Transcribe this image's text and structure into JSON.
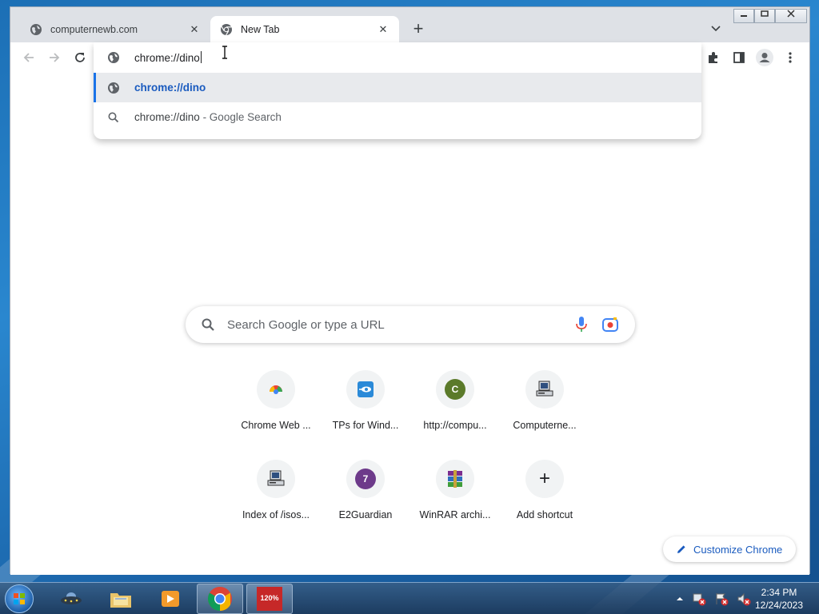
{
  "window": {
    "tabs": [
      {
        "title": "computernewb.com",
        "active": false,
        "close": "✕"
      },
      {
        "title": "New Tab",
        "active": true,
        "close": "✕"
      }
    ],
    "new_tab_symbol": "+",
    "controls": [
      "minimize",
      "restore",
      "close"
    ]
  },
  "omnibox": {
    "text": "chrome://dino",
    "suggestions": [
      {
        "icon": "globe-icon",
        "text": "chrome://dino",
        "suffix": "",
        "selected": true
      },
      {
        "icon": "search-icon",
        "text": "chrome://dino",
        "suffix": "- Google Search",
        "selected": false
      }
    ]
  },
  "search": {
    "placeholder": "Search Google or type a URL"
  },
  "shortcuts": [
    {
      "label": "Chrome Web ...",
      "icon": "chrome-web-store-icon"
    },
    {
      "label": "TPs for Wind...",
      "icon": "tps-icon"
    },
    {
      "label": "http://compu...",
      "icon": "letter-c-icon",
      "letter": "C",
      "color": "#5b7a2a"
    },
    {
      "label": "Computerne...",
      "icon": "computer-icon"
    },
    {
      "label": "Index of /isos...",
      "icon": "computer-icon"
    },
    {
      "label": "E2Guardian",
      "icon": "letter-7-icon",
      "letter": "7",
      "color": "#6d3a8a"
    },
    {
      "label": "WinRAR archi...",
      "icon": "winrar-icon"
    },
    {
      "label": "Add shortcut",
      "icon": "plus-icon",
      "symbol": "+"
    }
  ],
  "customize": {
    "label": "Customize Chrome"
  },
  "taskbar": {
    "time": "2:34 PM",
    "date": "12/24/2023",
    "badge": "120%"
  },
  "colors": {
    "accent": "#1a73e8",
    "link": "#1a5bbf"
  }
}
